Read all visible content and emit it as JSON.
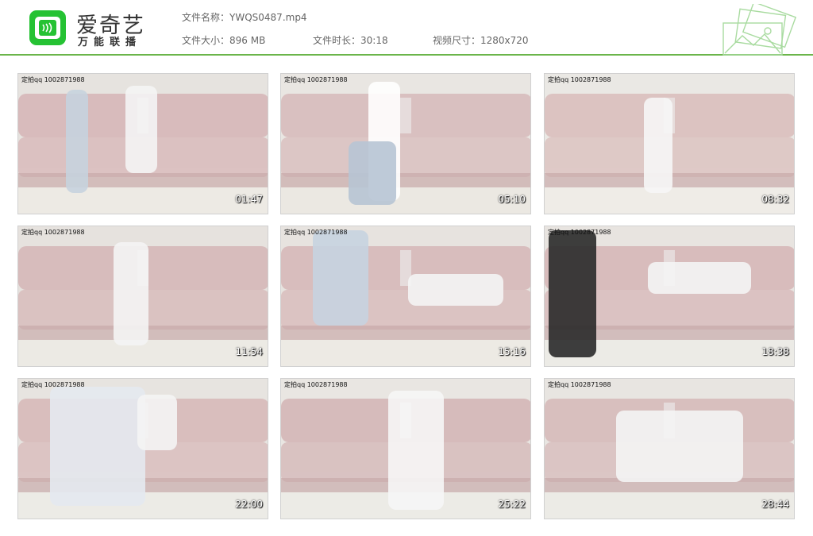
{
  "brand": {
    "name": "爱奇艺",
    "sub": "万能联播"
  },
  "file": {
    "name_label": "文件名称：",
    "name_value": "YWQS0487.mp4",
    "size_label": "文件大小：",
    "size_value": "896 MB",
    "duration_label": "文件时长：",
    "duration_value": "30:18",
    "dims_label": "视频尺寸：",
    "dims_value": "1280x720"
  },
  "thumbnails": [
    {
      "watermark": "定拍qq 1002871988",
      "timestamp": "01:47"
    },
    {
      "watermark": "定拍qq 1002871988",
      "timestamp": "05:10"
    },
    {
      "watermark": "定拍qq 1002871988",
      "timestamp": "08:32"
    },
    {
      "watermark": "定拍qq 1002871988",
      "timestamp": "11:54"
    },
    {
      "watermark": "定拍qq 1002871988",
      "timestamp": "15:16"
    },
    {
      "watermark": "定拍qq 1002871988",
      "timestamp": "18:38"
    },
    {
      "watermark": "定拍qq 1002871988",
      "timestamp": "22:00"
    },
    {
      "watermark": "定拍qq 1002871988",
      "timestamp": "25:22"
    },
    {
      "watermark": "定拍qq 1002871988",
      "timestamp": "28:44"
    }
  ],
  "colors": {
    "accent": "#25c233",
    "divider": "#6bb54a",
    "sofa": "#d9bdbd",
    "floor": "#ecebe6"
  }
}
